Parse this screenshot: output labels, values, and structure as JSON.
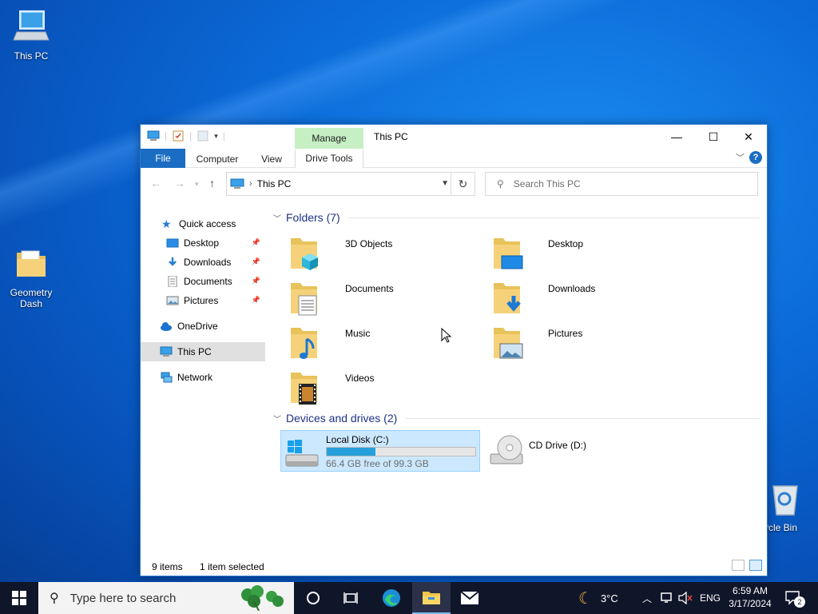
{
  "desktop": {
    "icons": [
      {
        "label": "This PC"
      },
      {
        "label": "Geometry Dash"
      },
      {
        "label": "cycle Bin"
      }
    ]
  },
  "window": {
    "title": "This PC",
    "manage_label": "Manage",
    "controls": {
      "minimize": "—",
      "maximize": "☐",
      "close": "✕"
    },
    "ribbon_tabs": [
      "File",
      "Computer",
      "View",
      "Drive Tools"
    ],
    "help": "?"
  },
  "address": {
    "path": "This PC",
    "search_placeholder": "Search This PC"
  },
  "nav_pane": {
    "items": [
      {
        "label": "Quick access",
        "icon": "star-icon"
      },
      {
        "label": "Desktop",
        "icon": "desktop-icon",
        "pinned": true
      },
      {
        "label": "Downloads",
        "icon": "download-icon",
        "pinned": true
      },
      {
        "label": "Documents",
        "icon": "document-icon",
        "pinned": true
      },
      {
        "label": "Pictures",
        "icon": "pictures-icon",
        "pinned": true
      },
      {
        "label": "OneDrive",
        "icon": "cloud-icon"
      },
      {
        "label": "This PC",
        "icon": "computer-icon",
        "selected": true
      },
      {
        "label": "Network",
        "icon": "network-icon"
      }
    ]
  },
  "folders": {
    "header": "Folders (7)",
    "items": [
      {
        "name": "3D Objects",
        "icon": "3d-objects-icon"
      },
      {
        "name": "Desktop",
        "icon": "desktop-folder-icon"
      },
      {
        "name": "Documents",
        "icon": "documents-folder-icon"
      },
      {
        "name": "Downloads",
        "icon": "downloads-folder-icon"
      },
      {
        "name": "Music",
        "icon": "music-folder-icon"
      },
      {
        "name": "Pictures",
        "icon": "pictures-folder-icon"
      },
      {
        "name": "Videos",
        "icon": "videos-folder-icon"
      }
    ]
  },
  "drives": {
    "header": "Devices and drives (2)",
    "items": [
      {
        "name": "Local Disk (C:)",
        "free_text": "66.4 GB free of 99.3 GB",
        "used_fraction": 0.33,
        "selected": true
      },
      {
        "name": "CD Drive (D:)"
      }
    ]
  },
  "status": {
    "items": "9 items",
    "selected": "1 item selected"
  },
  "taskbar": {
    "search_placeholder": "Type here to search",
    "weather": "3°C",
    "lang": "ENG",
    "time": "6:59 AM",
    "date": "3/17/2024",
    "notifications": "2"
  },
  "colors": {
    "accent": "#1a6dc3",
    "selection": "#cce8ff",
    "manage_tab": "#c6efc3",
    "taskbar": "#10162a",
    "drive_bar": "#26a0da"
  }
}
